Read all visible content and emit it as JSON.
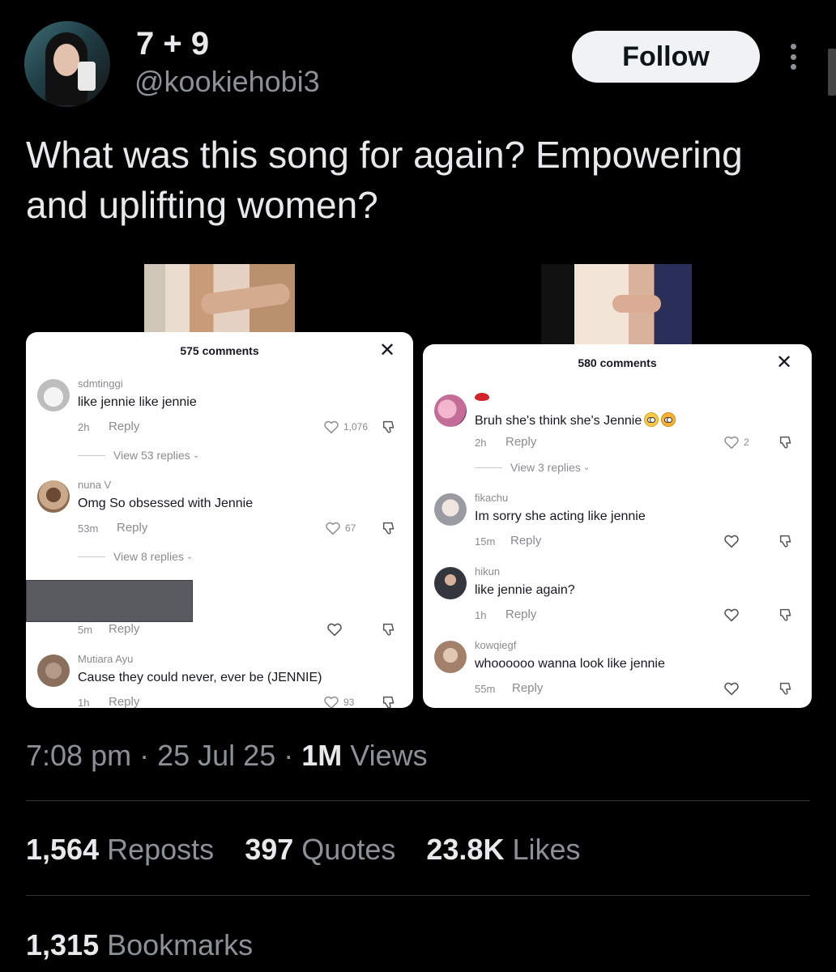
{
  "author": {
    "display_name": "7 + 9",
    "handle": "@kookiehobi3"
  },
  "follow_label": "Follow",
  "tweet_text": "What was this song for again? Empowering and uplifting women?",
  "media": {
    "left_card": {
      "title": "575 comments",
      "comments": [
        {
          "user": "sdmtinggi",
          "text": "like jennie like jennie",
          "time": "2h",
          "reply": "Reply",
          "likes": "1,076",
          "view_replies": "View 53 replies"
        },
        {
          "user": "nuna V",
          "text": "Omg So obsessed with Jennie",
          "time": "53m",
          "reply": "Reply",
          "likes": "67",
          "view_replies": "View 8 replies"
        },
        {
          "user": "",
          "text": "",
          "time": "5m",
          "reply": "Reply",
          "likes": ""
        },
        {
          "user": "Mutiara Ayu",
          "text": "Cause they could never, ever be (JENNIE)",
          "time": "1h",
          "reply": "Reply",
          "likes": "93"
        }
      ]
    },
    "right_card": {
      "title": "580 comments",
      "comments": [
        {
          "user": "",
          "text": "Bruh she's think she's Jennie",
          "time": "2h",
          "reply": "Reply",
          "likes": "2",
          "view_replies": "View 3 replies",
          "emojis": [
            "face-with-rolling-eyes",
            "smirking-face"
          ]
        },
        {
          "user": "fikachu",
          "text": "Im sorry she acting like jennie",
          "time": "15m",
          "reply": "Reply",
          "likes": ""
        },
        {
          "user": "hikun",
          "text": "like jennie again?",
          "time": "1h",
          "reply": "Reply",
          "likes": ""
        },
        {
          "user": "kowqiegf",
          "text": "whoooooo wanna look like jennie",
          "time": "55m",
          "reply": "Reply",
          "likes": ""
        }
      ]
    }
  },
  "meta": {
    "time": "7:08 pm",
    "sep1": "·",
    "date": "25 Jul 25",
    "sep2": "·",
    "views_count": "1M",
    "views_label": "Views"
  },
  "stats": {
    "reposts": {
      "count": "1,564",
      "label": "Reposts"
    },
    "quotes": {
      "count": "397",
      "label": "Quotes"
    },
    "likes": {
      "count": "23.8K",
      "label": "Likes"
    },
    "bookmarks": {
      "count": "1,315",
      "label": "Bookmarks"
    }
  },
  "icons": {
    "more": "more-vertical-icon",
    "close": "close-icon",
    "heart": "heart-icon",
    "dislike": "thumbs-down-icon",
    "chevron": "chevron-down-icon"
  },
  "colors": {
    "background": "#000000",
    "text_primary": "#e7e9ea",
    "text_secondary": "#8b9197",
    "follow_bg": "#eff3f4",
    "divider": "#2f3336"
  }
}
